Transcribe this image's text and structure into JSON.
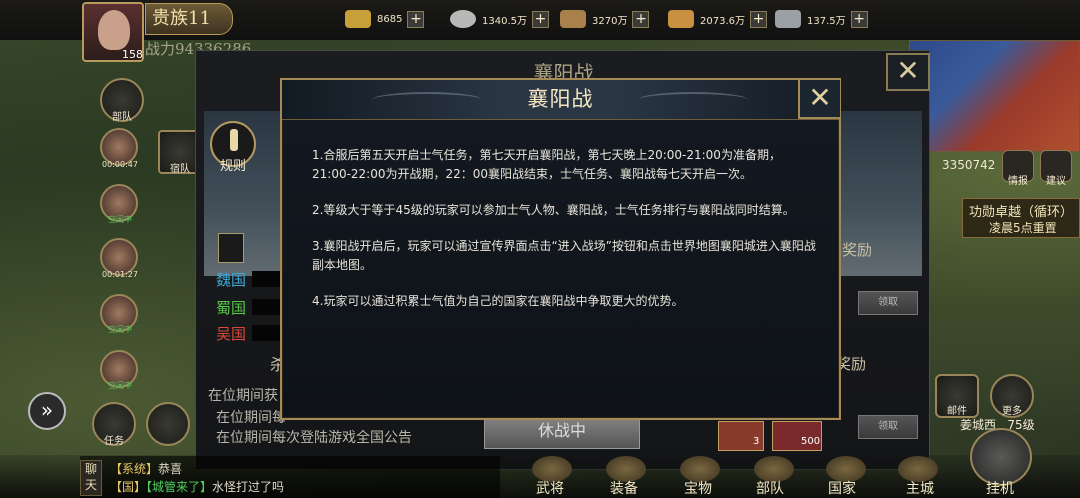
{
  "header": {
    "noble_rank": "贵族11",
    "power_label": "战力94336286",
    "level": "158",
    "resources": [
      {
        "icon": "gold-ingot-icon",
        "value": "8685"
      },
      {
        "icon": "silver-coin-icon",
        "value": "1340.5万"
      },
      {
        "icon": "wood-log-icon",
        "value": "3270万"
      },
      {
        "icon": "grain-icon",
        "value": "2073.6万"
      },
      {
        "icon": "iron-icon",
        "value": "137.5万"
      }
    ]
  },
  "left_column": {
    "troops_label": "部队",
    "dormitory_label": "宿队",
    "heroes": [
      {
        "status": "00:00:47"
      },
      {
        "status": "空闲中"
      },
      {
        "status": "00:01:27"
      },
      {
        "status": "空闲中"
      },
      {
        "status": "空闲中"
      }
    ],
    "task_label": "任务"
  },
  "background_panel": {
    "title": "襄阳战",
    "rules_label": "规则",
    "kingdoms": [
      "魏国",
      "蜀国",
      "吴国"
    ],
    "reward_label_1": "奖励",
    "reward_label_2": "奖励",
    "claim_label": "领取",
    "rows": [
      "在位期间获",
      "在位期间每",
      "在位期间每次登陆游戏全国公告"
    ],
    "battle_status": "休战中",
    "item_count_1": "3",
    "item_count_2": "500"
  },
  "dialog": {
    "title": "襄阳战",
    "paragraphs": [
      "1.合服后第五天开启士气任务，第七天开启襄阳战，第七天晚上20:00-21:00为准备期，21:00-22:00为开战期，22：00襄阳战结束，士气任务、襄阳战每七天开启一次。",
      "2.等级大于等于45级的玩家可以参加士气人物、襄阳战，士气任务排行与襄阳战同时结算。",
      "3.襄阳战开启后，玩家可以通过宣传界面点击“进入战场”按钮和点击世界地图襄阳城进入襄阳战副本地图。",
      "4.玩家可以通过积累士气值为自己的国家在襄阳战中争取更大的优势。"
    ]
  },
  "right_side": {
    "score": "3350742",
    "intel_label": "情报",
    "suggest_label": "建议",
    "merit_title": "功勋卓越（循环）",
    "merit_sub": "凌晨5点重置",
    "mail_label": "邮件",
    "more_label": "更多",
    "location": "姜城西",
    "location_level": "75级"
  },
  "chat": {
    "channel_label": "聊天",
    "line1_tag": "【系统】",
    "line1_text": "恭喜",
    "line2_tag": "【国】",
    "line2_name": "【城管来了】",
    "line2_text": "水怪打过了吗"
  },
  "bottom_nav": [
    "武将",
    "装备",
    "宝物",
    "部队",
    "国家",
    "主城",
    "挂机"
  ],
  "colors": {
    "wei": "#3fa9d6",
    "shu": "#58c84a",
    "wu": "#d84a3a",
    "gold_border": "#a38a56",
    "idle_green": "#4fd060"
  }
}
